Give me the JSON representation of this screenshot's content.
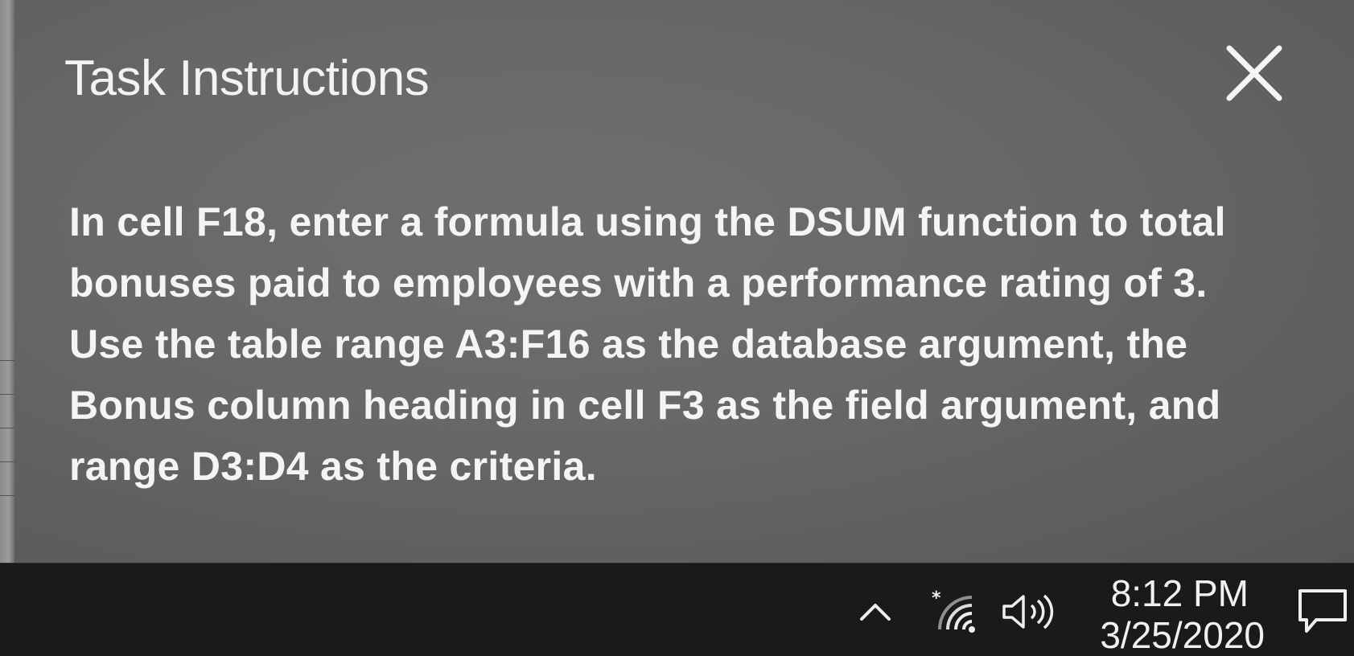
{
  "dialog": {
    "title": "Task Instructions",
    "close_icon": "close-icon",
    "instructions": "In cell F18, enter a formula using the DSUM function to total bonuses paid to employees with a performance rating of 3. Use the table range A3:F16 as the database argument, the Bonus column heading in cell F3 as the field argument, and range D3:D4 as the criteria."
  },
  "taskbar": {
    "tray_icons": [
      "chevron-up-icon",
      "wifi-icon",
      "volume-icon",
      "notification-icon"
    ],
    "time": "8:12 PM",
    "date": "3/25/2020"
  },
  "colors": {
    "panel_background": "#676767",
    "dialog_text": "#f4f4f4",
    "taskbar_background": "#1a1a1a"
  }
}
